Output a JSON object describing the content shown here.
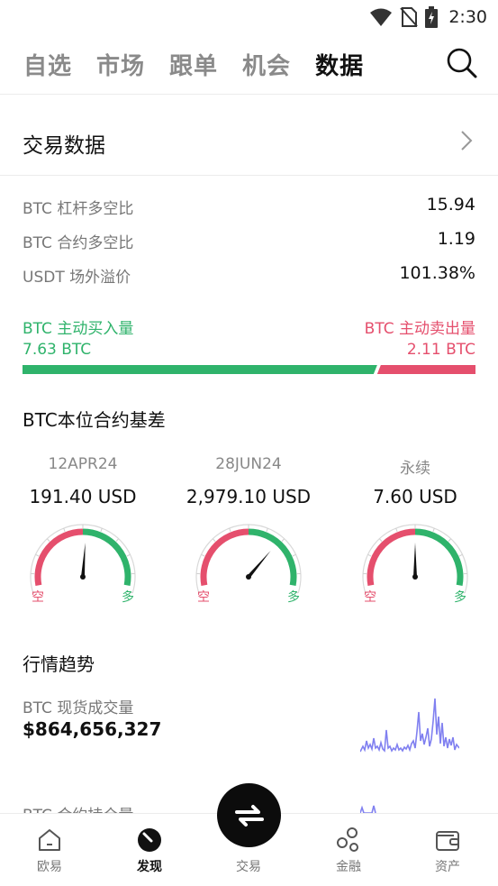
{
  "status_bar": {
    "time": "2:30",
    "icons": [
      "wifi-icon",
      "no-sim-icon",
      "battery-charging-icon"
    ]
  },
  "top_tabs": [
    {
      "label": "自选",
      "active": false
    },
    {
      "label": "市场",
      "active": false
    },
    {
      "label": "跟单",
      "active": false
    },
    {
      "label": "机会",
      "active": false
    },
    {
      "label": "数据",
      "active": true
    }
  ],
  "trade_data": {
    "title": "交易数据",
    "metrics": [
      {
        "label": "BTC 杠杆多空比",
        "value": "15.94"
      },
      {
        "label": "BTC 合约多空比",
        "value": "1.19"
      },
      {
        "label": "USDT 场外溢价",
        "value": "101.38%"
      }
    ],
    "buy": {
      "label": "BTC 主动买入量",
      "amount": "7.63 BTC"
    },
    "sell": {
      "label": "BTC 主动卖出量",
      "amount": "2.11 BTC"
    },
    "buy_ratio": 0.783
  },
  "basis": {
    "title": "BTC本位合约基差",
    "short_label": "空",
    "long_label": "多",
    "items": [
      {
        "date": "12APR24",
        "value": "191.40 USD",
        "needle": 0.52
      },
      {
        "date": "28JUN24",
        "value": "2,979.10 USD",
        "needle": 0.7
      },
      {
        "date": "永续",
        "value": "7.60 USD",
        "needle": 0.5
      }
    ]
  },
  "trend": {
    "title": "行情趋势",
    "items": [
      {
        "label": "BTC 现货成交量",
        "value": "$864,656,327"
      },
      {
        "label": "BTC 合约持仓量",
        "value": ""
      }
    ]
  },
  "bottom_nav": [
    {
      "label": "欧易",
      "icon": "home-icon",
      "active": false
    },
    {
      "label": "发现",
      "icon": "discover-icon",
      "active": true
    },
    {
      "label": "交易",
      "icon": "trade-swap-icon",
      "active": false
    },
    {
      "label": "金融",
      "icon": "finance-icon",
      "active": false
    },
    {
      "label": "资产",
      "icon": "wallet-icon",
      "active": false
    }
  ],
  "colors": {
    "green": "#2fb36b",
    "red": "#e54f6d",
    "sparkline": "#8080f0"
  }
}
